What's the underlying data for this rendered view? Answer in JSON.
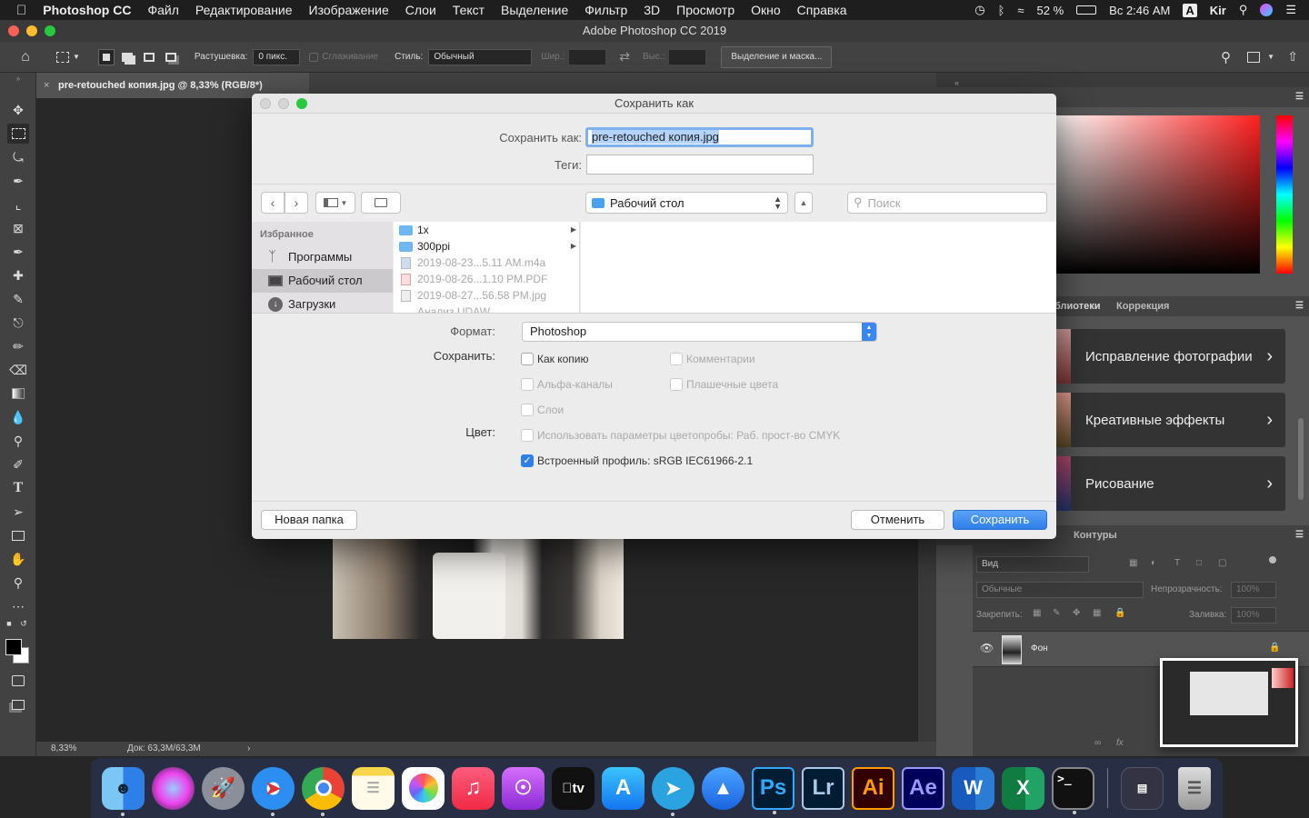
{
  "menubar": {
    "app_name": "Photoshop CC",
    "items": [
      "Файл",
      "Редактирование",
      "Изображение",
      "Слои",
      "Текст",
      "Выделение",
      "Фильтр",
      "3D",
      "Просмотр",
      "Окно",
      "Справка"
    ],
    "battery": "52 %",
    "clock": "Вс 2:46 AM",
    "input_lang": "A",
    "user": "Kir"
  },
  "window_title": "Adobe Photoshop CC 2019",
  "options": {
    "feather_label": "Растушевка:",
    "feather_value": "0 пикс.",
    "antialias_label": "Сглаживание",
    "style_label": "Стиль:",
    "style_value": "Обычный",
    "width_label": "Шир.:",
    "height_label": "Выс.:",
    "mask_button": "Выделение и маска..."
  },
  "doc_tab": {
    "title": "pre-retouched копия.jpg @ 8,33% (RGB/8*)"
  },
  "status": {
    "zoom": "8,33%",
    "doc": "Док: 63,3M/63,3M"
  },
  "right_panel": {
    "libraries_tab": "блиотеки",
    "correction_tab": "Коррекция",
    "learn_cards": [
      "Исправление фотографии",
      "Креативные эффекты",
      "Рисование"
    ],
    "paths_tab": "Контуры",
    "layers": {
      "kind_placeholder": "Вид",
      "blend_mode": "Обычные",
      "opacity_label": "Непрозрачность:",
      "opacity_value": "100%",
      "lock_label": "Закрепить:",
      "fill_label": "Заливка:",
      "fill_value": "100%",
      "layer_name": "Фон"
    }
  },
  "dialog": {
    "title": "Сохранить как",
    "save_as_label": "Сохранить как:",
    "filename": "pre-retouched копия.jpg",
    "tags_label": "Теги:",
    "location": "Рабочий стол",
    "search_placeholder": "Поиск",
    "sidebar_heading": "Избранное",
    "sidebar_items": [
      "Программы",
      "Рабочий стол",
      "Загрузки"
    ],
    "files": [
      {
        "name": "1x",
        "type": "folder"
      },
      {
        "name": "300ppi",
        "type": "folder"
      },
      {
        "name": "2019-08-23...5.11 AM.m4a",
        "type": "file"
      },
      {
        "name": "2019-08-26...1.10 PM.PDF",
        "type": "file"
      },
      {
        "name": "2019-08-27...56.58 PM.jpg",
        "type": "file"
      },
      {
        "name": "Анализ UDAW",
        "type": "file"
      }
    ],
    "format_label": "Формат:",
    "format_value": "Photoshop",
    "save_label": "Сохранить:",
    "options": {
      "as_copy": "Как копию",
      "comments": "Комментарии",
      "alpha": "Альфа-каналы",
      "spot": "Плашечные цвета",
      "layers": "Слои"
    },
    "color_label": "Цвет:",
    "proof_setup": "Использовать параметры цветопробы:  Раб. прост-во CMYK",
    "embed_profile": "Встроенный профиль:  sRGB IEC61966-2.1",
    "new_folder": "Новая папка",
    "cancel": "Отменить",
    "save": "Сохранить"
  },
  "colors": {
    "accent": "#2f7fe8",
    "panel": "#535353",
    "dialog_bg": "#ececec"
  }
}
